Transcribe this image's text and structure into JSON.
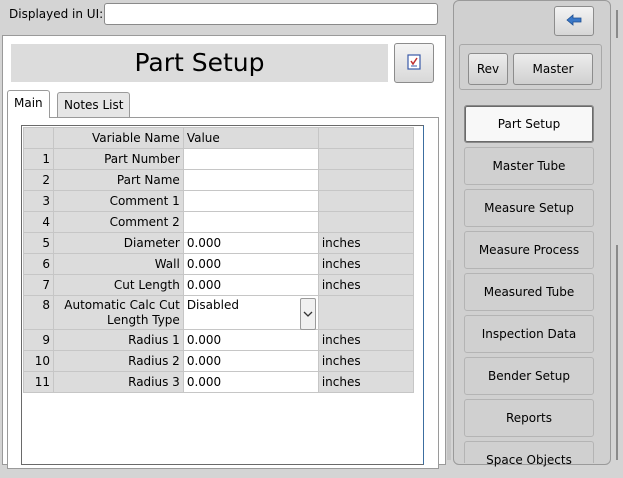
{
  "top_bar": {
    "label": "Displayed in UI:",
    "input_value": ""
  },
  "panel": {
    "title": "Part Setup",
    "tabs": [
      "Main",
      "Notes List"
    ],
    "icons": {
      "checklist": "checklist-icon",
      "back": "arrow-left-icon",
      "dropdown": "chevron-down-icon"
    }
  },
  "grid": {
    "headers": {
      "number": "",
      "name": "Variable Name",
      "value": "Value",
      "unit": ""
    },
    "rows": [
      {
        "num": "1",
        "name": "Part Number",
        "value": "",
        "unit": ""
      },
      {
        "num": "2",
        "name": "Part Name",
        "value": "",
        "unit": ""
      },
      {
        "num": "3",
        "name": "Comment 1",
        "value": "",
        "unit": ""
      },
      {
        "num": "4",
        "name": "Comment 2",
        "value": "",
        "unit": ""
      },
      {
        "num": "5",
        "name": "Diameter",
        "value": "0.000",
        "unit": "inches"
      },
      {
        "num": "6",
        "name": "Wall",
        "value": "0.000",
        "unit": "inches"
      },
      {
        "num": "7",
        "name": "Cut Length",
        "value": "0.000",
        "unit": "inches"
      },
      {
        "num": "8",
        "name": "Automatic Calc Cut Length Type",
        "value": "Disabled",
        "unit": ""
      },
      {
        "num": "9",
        "name": "Radius 1",
        "value": "0.000",
        "unit": "inches"
      },
      {
        "num": "10",
        "name": "Radius 2",
        "value": "0.000",
        "unit": "inches"
      },
      {
        "num": "11",
        "name": "Radius 3",
        "value": "0.000",
        "unit": "inches"
      }
    ]
  },
  "sidebar": {
    "rev_label": "Rev",
    "master_label": "Master",
    "nav": [
      "Part Setup",
      "Master Tube",
      "Measure Setup",
      "Measure Process",
      "Measured Tube",
      "Inspection Data",
      "Bender Setup",
      "Reports",
      "Space Objects"
    ],
    "active": "Part Setup"
  },
  "colors": {
    "accent_blue": "#3a78c8",
    "panel_gray": "#d4d4d4"
  }
}
